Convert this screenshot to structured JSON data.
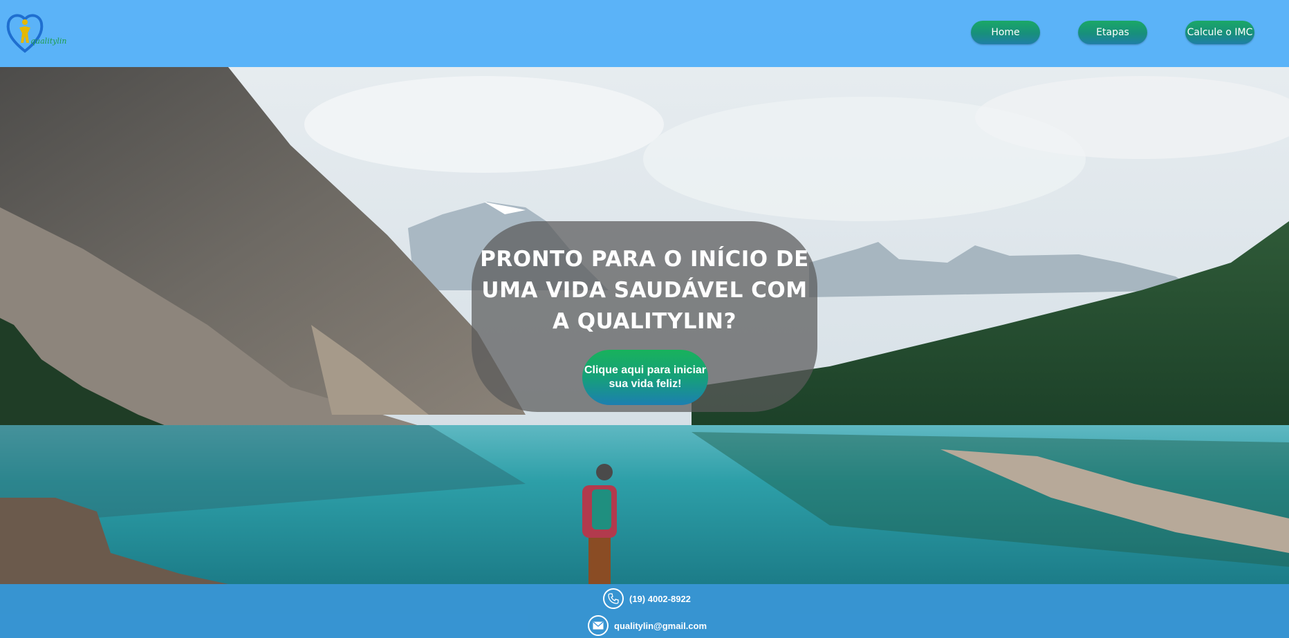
{
  "header": {
    "logo_text": "qualitylin",
    "nav": [
      {
        "label": "Home"
      },
      {
        "label": "Etapas"
      },
      {
        "label": "Calcule o IMC"
      }
    ]
  },
  "hero": {
    "title": "PRONTO PARA O INÍCIO DE UMA VIDA SAUDÁVEL COM A QUALITYLIN?",
    "cta_label": "Clique aqui para iniciar sua vida feliz!"
  },
  "footer": {
    "phone": "(19) 4002-8922",
    "email": "qualitylin@gmail.com"
  },
  "colors": {
    "header_bg": "#4eaef8",
    "button_green": "#1aa866",
    "button_blue": "#1f7fa7",
    "footer_bg": "#3a96de"
  },
  "icons": {
    "logo": "heart-person-logo-icon",
    "phone": "phone-icon",
    "email": "envelope-icon"
  }
}
